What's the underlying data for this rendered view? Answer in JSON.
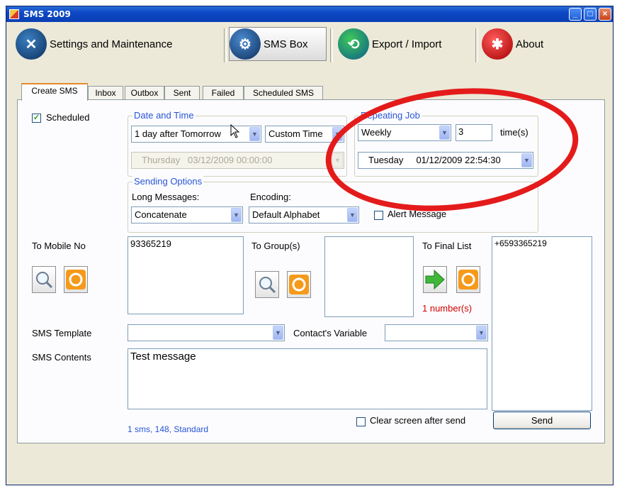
{
  "window": {
    "title": "SMS 2009"
  },
  "toolbar": {
    "settings_label": "Settings and Maintenance",
    "smsbox_label": "SMS Box",
    "export_label": "Export / Import",
    "about_label": "About"
  },
  "tabs": [
    "Create SMS",
    "Inbox",
    "Outbox",
    "Sent",
    "Failed",
    "Scheduled SMS"
  ],
  "form": {
    "scheduled_label": "Scheduled",
    "scheduled_checked": true,
    "date_time": {
      "caption": "Date and Time",
      "day_value": "1 day after Tomorrow",
      "time_value": "Custom Time",
      "datetime_day": "Thursday",
      "datetime_value": "03/12/2009 00:00:00"
    },
    "repeating": {
      "caption": "Repeating Job",
      "frequency": "Weekly",
      "times_value": "3",
      "times_label": "time(s)",
      "start_day": "Tuesday",
      "start_value": "01/12/2009 22:54:30"
    },
    "sending": {
      "caption": "Sending Options",
      "long_label": "Long Messages:",
      "long_value": "Concatenate",
      "encoding_label": "Encoding:",
      "encoding_value": "Default Alphabet",
      "alert_label": "Alert Message"
    },
    "to_mobile_label": "To Mobile No",
    "to_mobile_value": "93365219",
    "to_group_label": "To Group(s)",
    "to_final_label": "To Final List",
    "final_list_value": "+6593365219",
    "final_count": "1 number(s)",
    "template_label": "SMS Template",
    "contact_var_label": "Contact's Variable",
    "contents_label": "SMS Contents",
    "contents_value": "Test message",
    "status": "1 sms, 148, Standard",
    "clear_label": "Clear screen after send",
    "send_label": "Send"
  },
  "colors": {
    "accent": "#2855d6",
    "annotation": "#e41b1b",
    "count": "#d00000"
  }
}
